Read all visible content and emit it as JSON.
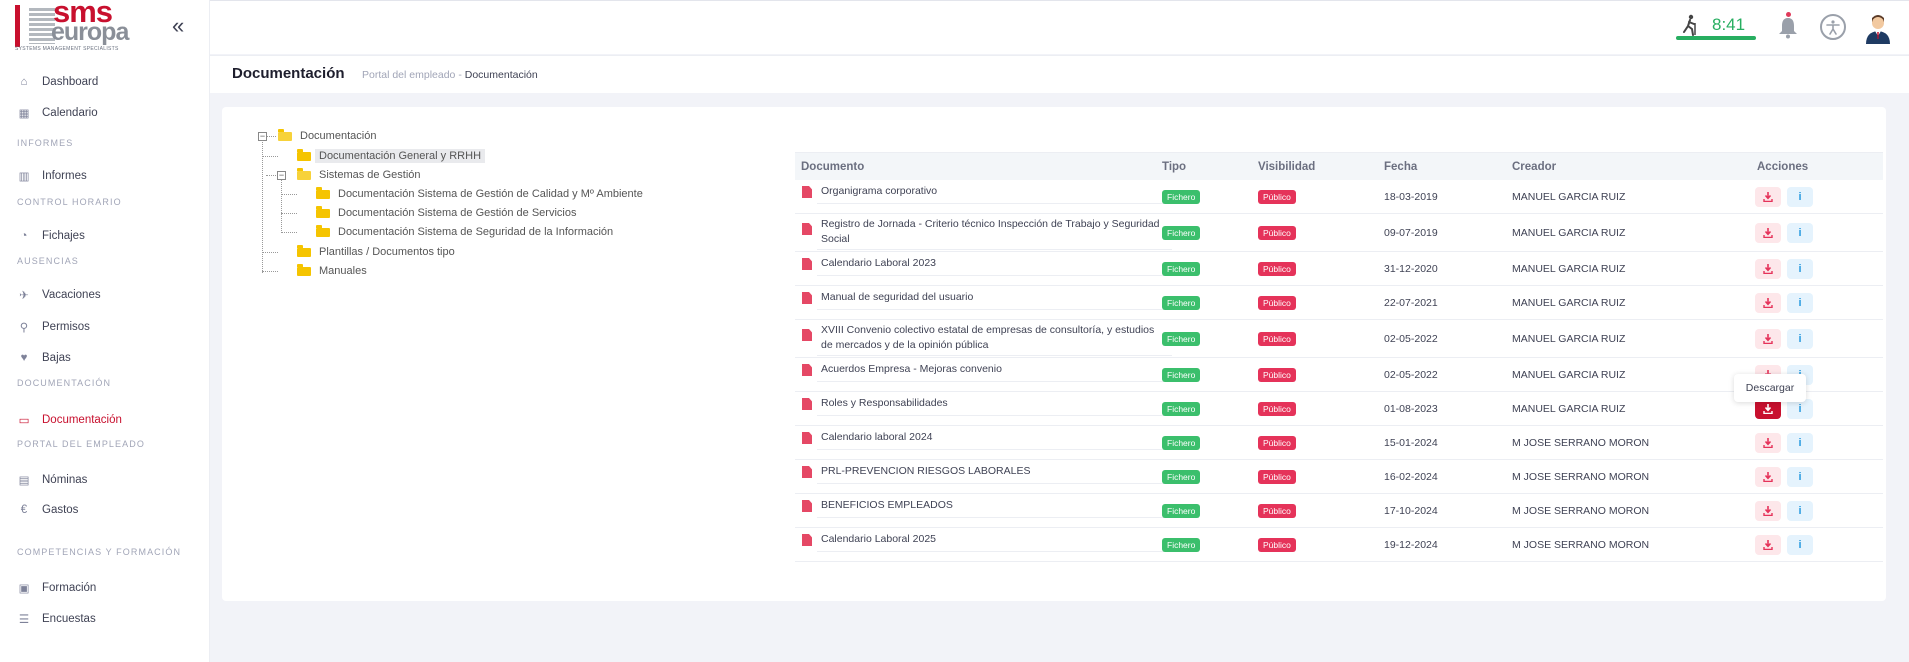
{
  "brand": {
    "name_top": "sms",
    "name_bottom": "europa",
    "tagline": "SYSTEMS MANAGEMENT SPECIALISTS"
  },
  "sidebar": {
    "collapse_icon": "double-chevron-left-icon",
    "items": [
      {
        "label": "Dashboard",
        "icon": "home-icon"
      },
      {
        "label": "Calendario",
        "icon": "calendar-icon"
      },
      {
        "section": "INFORMES"
      },
      {
        "label": "Informes",
        "icon": "chart-icon"
      },
      {
        "section": "CONTROL HORARIO"
      },
      {
        "label": "Fichajes",
        "icon": "stopwatch-icon"
      },
      {
        "section": "AUSENCIAS"
      },
      {
        "label": "Vacaciones",
        "icon": "plane-icon"
      },
      {
        "label": "Permisos",
        "icon": "walk-icon"
      },
      {
        "label": "Bajas",
        "icon": "heartbeat-icon"
      },
      {
        "section": "DOCUMENTACIÓN"
      },
      {
        "label": "Documentación",
        "icon": "folder-open-icon",
        "active": true
      },
      {
        "section": "PORTAL DEL EMPLEADO"
      },
      {
        "label": "Nóminas",
        "icon": "file-icon"
      },
      {
        "label": "Gastos",
        "icon": "euro-icon"
      },
      {
        "section": "COMPETENCIAS Y FORMACIÓN"
      },
      {
        "label": "Formación",
        "icon": "chalkboard-icon"
      },
      {
        "label": "Encuestas",
        "icon": "list-icon"
      }
    ]
  },
  "topbar": {
    "time": "8:41",
    "accent_green": "#27ae60"
  },
  "header": {
    "title": "Documentación",
    "breadcrumb_parent": "Portal del empleado",
    "breadcrumb_sep": "-",
    "breadcrumb_current": "Documentación"
  },
  "tree": {
    "root": "Documentación",
    "nodes": [
      {
        "label": "Documentación General y RRHH",
        "selected": true
      },
      {
        "label": "Sistemas de Gestión"
      },
      {
        "label": "Documentación Sistema de Gestión de Calidad y Mº Ambiente"
      },
      {
        "label": "Documentación Sistema de Gestión de Servicios"
      },
      {
        "label": "Documentación Sistema de Seguridad de la Información"
      },
      {
        "label": "Plantillas / Documentos tipo"
      },
      {
        "label": "Manuales"
      }
    ]
  },
  "table": {
    "headers": {
      "documento": "Documento",
      "tipo": "Tipo",
      "visibilidad": "Visibilidad",
      "fecha": "Fecha",
      "creador": "Creador",
      "acciones": "Acciones"
    },
    "rows": [
      {
        "doc": "Organigrama corporativo",
        "tipo": "Fichero",
        "vis": "Público",
        "fecha": "18-03-2019",
        "creador": "MANUEL GARCIA RUIZ"
      },
      {
        "doc": "Registro de Jornada - Criterio técnico Inspección de Trabajo y Seguridad Social",
        "tipo": "Fichero",
        "vis": "Público",
        "fecha": "09-07-2019",
        "creador": "MANUEL GARCIA RUIZ"
      },
      {
        "doc": "Calendario Laboral 2023",
        "tipo": "Fichero",
        "vis": "Público",
        "fecha": "31-12-2020",
        "creador": "MANUEL GARCIA RUIZ"
      },
      {
        "doc": "Manual de seguridad del usuario",
        "tipo": "Fichero",
        "vis": "Público",
        "fecha": "22-07-2021",
        "creador": "MANUEL GARCIA RUIZ"
      },
      {
        "doc": "XVIII Convenio colectivo estatal de empresas de consultoría, y estudios de mercados y de la opinión pública",
        "tipo": "Fichero",
        "vis": "Público",
        "fecha": "02-05-2022",
        "creador": "MANUEL GARCIA RUIZ"
      },
      {
        "doc": "Acuerdos Empresa - Mejoras convenio",
        "tipo": "Fichero",
        "vis": "Público",
        "fecha": "02-05-2022",
        "creador": "MANUEL GARCIA RUIZ"
      },
      {
        "doc": "Roles y Responsabilidades",
        "tipo": "Fichero",
        "vis": "Público",
        "fecha": "01-08-2023",
        "creador": "MANUEL GARCIA RUIZ",
        "hover": true
      },
      {
        "doc": "Calendario laboral 2024",
        "tipo": "Fichero",
        "vis": "Público",
        "fecha": "15-01-2024",
        "creador": "M JOSE SERRANO MORON"
      },
      {
        "doc": "PRL-PREVENCION RIESGOS LABORALES",
        "tipo": "Fichero",
        "vis": "Público",
        "fecha": "16-02-2024",
        "creador": "M JOSE SERRANO MORON"
      },
      {
        "doc": "BENEFICIOS EMPLEADOS",
        "tipo": "Fichero",
        "vis": "Público",
        "fecha": "17-10-2024",
        "creador": "M JOSE SERRANO MORON"
      },
      {
        "doc": "Calendario Laboral 2025",
        "tipo": "Fichero",
        "vis": "Público",
        "fecha": "19-12-2024",
        "creador": "M JOSE SERRANO MORON"
      }
    ]
  },
  "tooltip": {
    "text": "Descargar"
  }
}
